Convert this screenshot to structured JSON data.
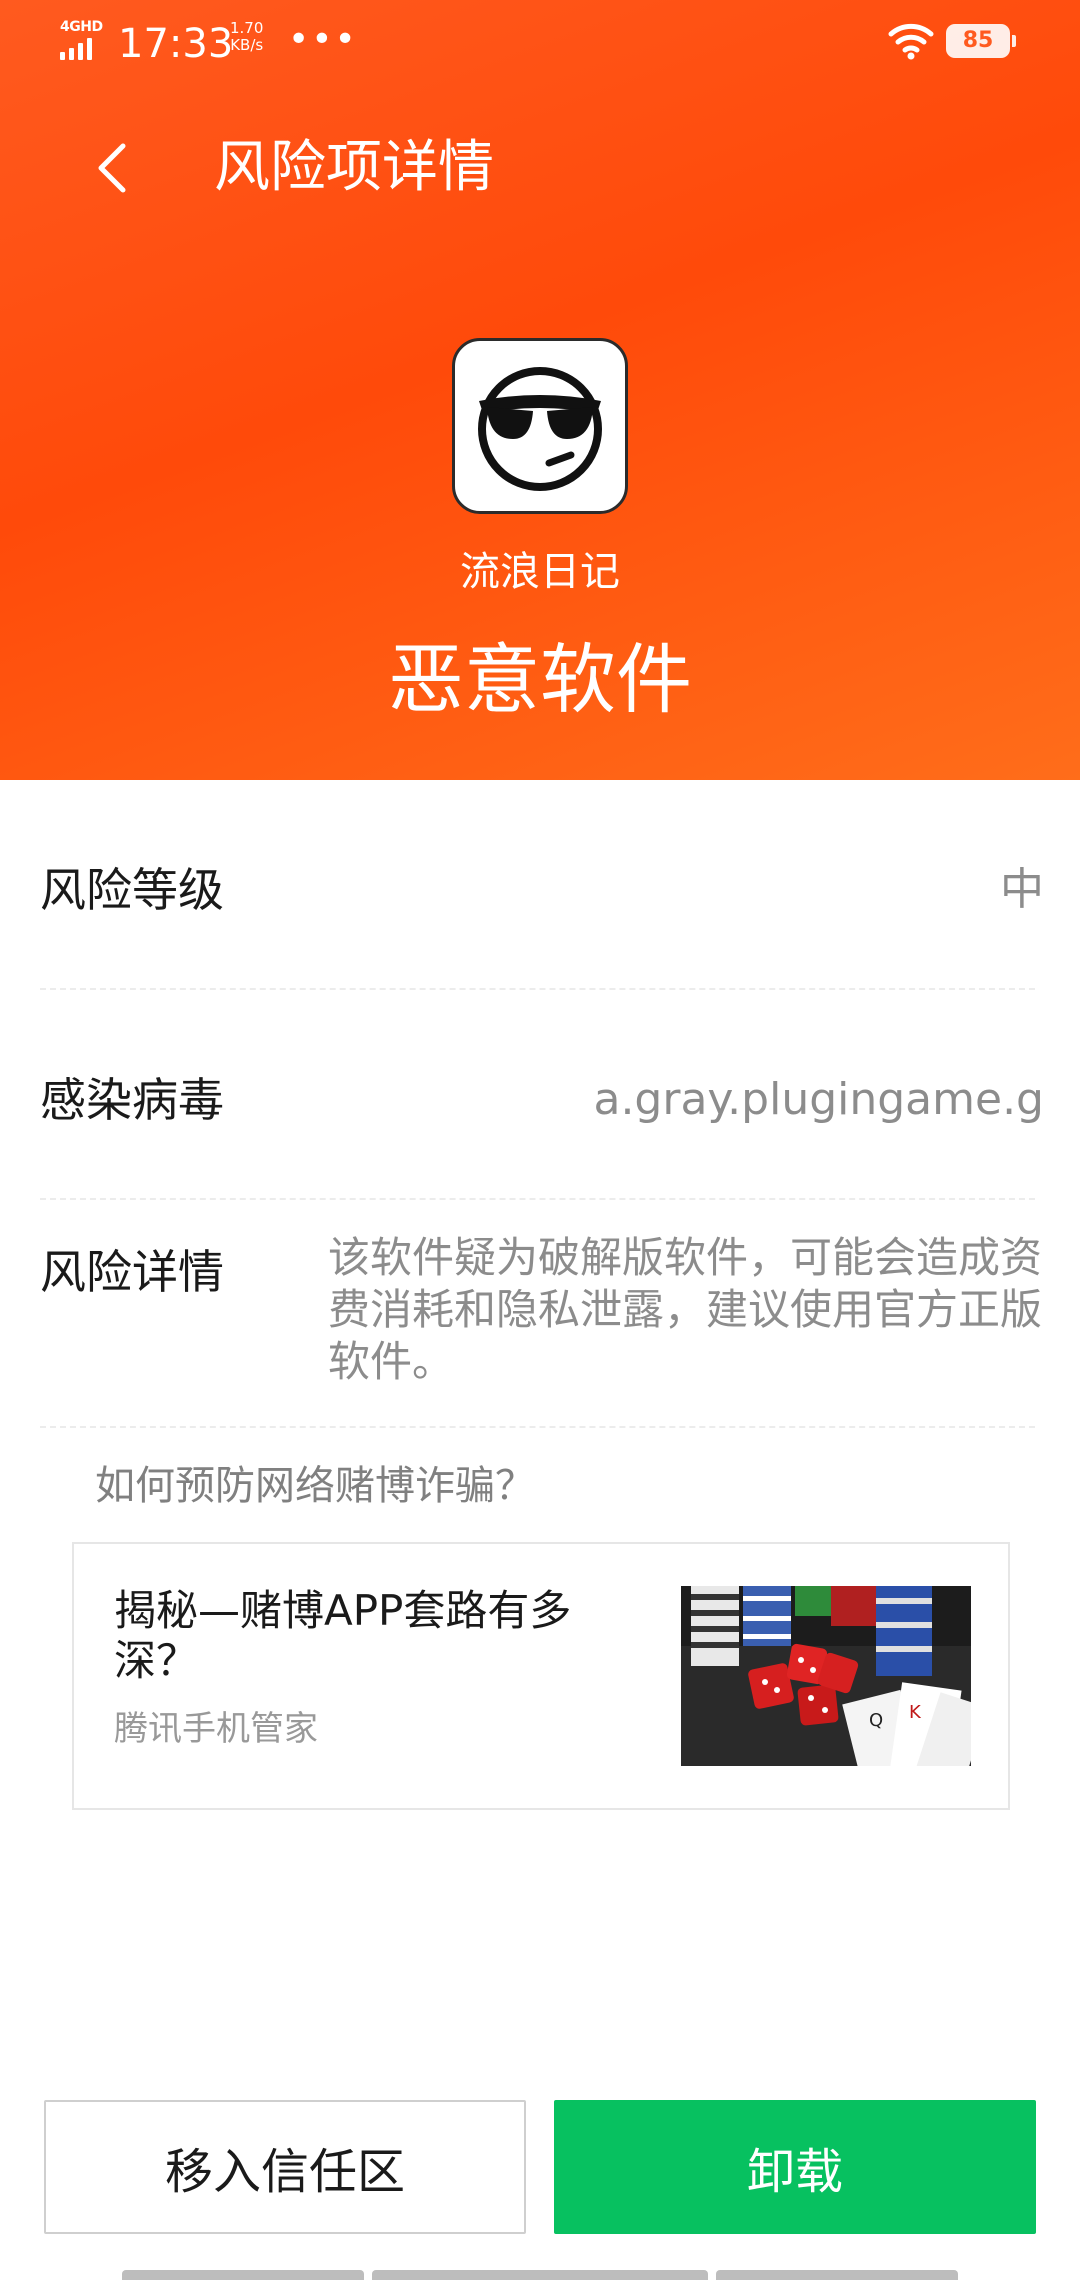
{
  "status_bar": {
    "network": "4GHD",
    "time": "17:33",
    "speed_value": "1.70",
    "speed_unit": "KB/s",
    "more": "•••",
    "battery": "85"
  },
  "header": {
    "title": "风险项详情",
    "app_name": "流浪日记",
    "threat_type": "恶意软件"
  },
  "rows": {
    "risk_level": {
      "label": "风险等级",
      "value": "中"
    },
    "virus": {
      "label": "感染病毒",
      "value": "a.gray.plugingame.g"
    },
    "detail": {
      "label": "风险详情",
      "value": "该软件疑为破解版软件，可能会造成资费消耗和隐私泄露，建议使用官方正版软件。"
    }
  },
  "prevention": {
    "heading": "如何预防网络赌博诈骗？",
    "article": {
      "title": "揭秘—赌博APP套路有多深？",
      "source": "腾讯手机管家"
    }
  },
  "actions": {
    "trust": "移入信任区",
    "uninstall": "卸载"
  },
  "colors": {
    "header": "#ff5a1f",
    "uninstall": "#07c160"
  }
}
